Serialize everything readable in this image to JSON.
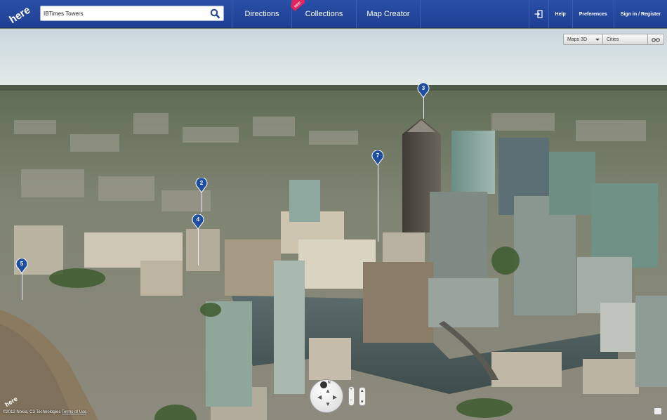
{
  "header": {
    "logo_text": "here",
    "search": {
      "value": "IBTimes Towers",
      "placeholder": ""
    },
    "nav": [
      {
        "label": "Directions"
      },
      {
        "label": "Collections",
        "badge": "NEW"
      },
      {
        "label": "Map Creator"
      }
    ],
    "links": {
      "help": "Help",
      "preferences": "Preferences",
      "signin": "Sign in / Register"
    }
  },
  "map_controls": {
    "view_mode": "Maps 3D",
    "layer": "Cities"
  },
  "pins": [
    {
      "label": "3"
    },
    {
      "label": "7"
    },
    {
      "label": "2"
    },
    {
      "label": "4"
    },
    {
      "label": "5"
    }
  ],
  "navigation": {
    "north": "N"
  },
  "footer": {
    "copyright": "©2012 Nokia, C3 Technologies",
    "terms": "Terms of Use"
  },
  "colors": {
    "header": "#2548a0",
    "pin": "#1f4da0",
    "badge": "#e0245e"
  }
}
